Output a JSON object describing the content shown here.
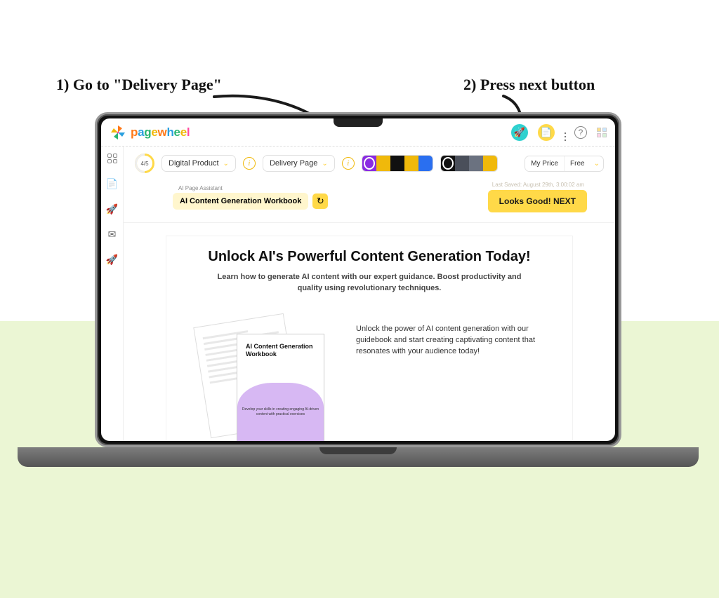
{
  "annotations": {
    "step1": "1) Go to \"Delivery Page\"",
    "step2": "2) Press next button"
  },
  "brand": {
    "name": "pagewheel"
  },
  "topbar": {
    "rocket_icon": "rocket-icon",
    "bell_icon": "bell-icon",
    "list_icon": "list-icon",
    "help_icon": "help-icon",
    "templates_icon": "templates-icon"
  },
  "sidebar": {
    "items": [
      "dashboard",
      "document",
      "launch",
      "mail",
      "promo"
    ]
  },
  "toolbar": {
    "progress": "4/5",
    "product_type": "Digital Product",
    "page_type": "Delivery Page",
    "palette1": [
      "#8a2be2",
      "#f0b90b",
      "#111111",
      "#f0b90b",
      "#2a6ff0"
    ],
    "palette2": [
      "#111111",
      "#4a4f5a",
      "#6b7280",
      "#f0b90b"
    ],
    "price_label": "My Price",
    "price_value": "Free"
  },
  "ai": {
    "label": "AI Page Assistant",
    "content": "AI Content Generation Workbook",
    "refresh": "↻"
  },
  "meta": {
    "saved": "Last Saved: August 29th, 3:00:02 am"
  },
  "buttons": {
    "next": "Looks Good! NEXT"
  },
  "preview": {
    "title": "Unlock AI's Powerful Content Generation Today!",
    "subtitle": "Learn how to generate AI content with our expert guidance. Boost productivity and quality using revolutionary techniques.",
    "doc_title": "AI Content Generation Workbook",
    "doc_tagline": "Develop your skills in creating engaging AI-driven content with practical exercises",
    "body": "Unlock the power of AI content generation with our guidebook and start creating captivating content that resonates with your audience today!"
  }
}
